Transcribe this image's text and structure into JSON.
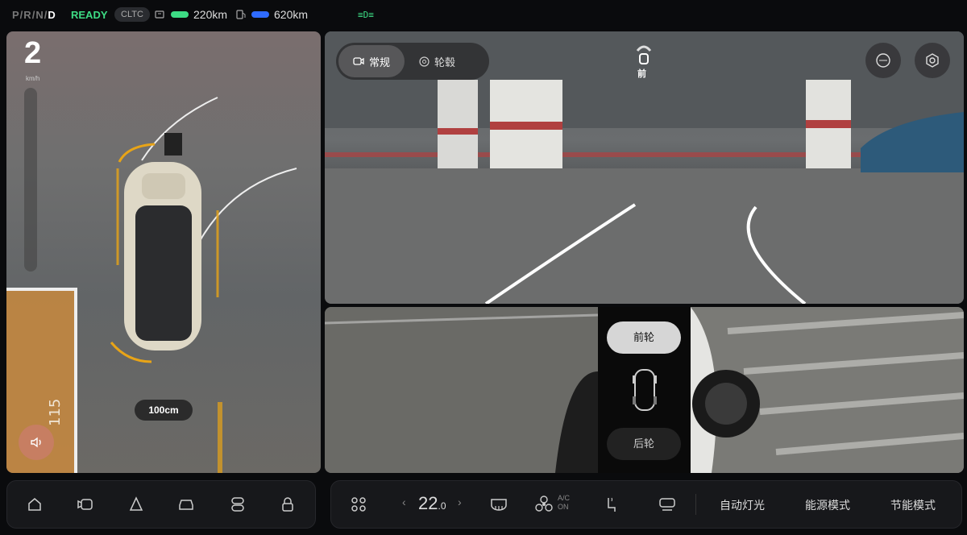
{
  "status": {
    "gears": [
      "P",
      "/",
      "R",
      "/",
      "N",
      "/",
      "D"
    ],
    "ready": "READY",
    "cltc": "CLTC",
    "range_total": "220km",
    "range_fuel": "620km",
    "light_indicator": "≡D≡",
    "battery_color": "#3ddc84",
    "fuel_color": "#2f6bff"
  },
  "left_view": {
    "speed": "2",
    "speed_unit": "km/h",
    "distance": "100cm"
  },
  "front_view": {
    "tabs": [
      {
        "label": "常规",
        "icon": "camera-icon"
      },
      {
        "label": "轮毂",
        "icon": "wheel-icon"
      }
    ],
    "camera_label": "前",
    "buttons": [
      "3d-view-icon",
      "settings-icon"
    ]
  },
  "wheel_view": {
    "front_wheel": "前轮",
    "rear_wheel": "后轮"
  },
  "dock": {
    "temperature": "22",
    "temperature_decimal": ".0",
    "ac_label": "A/C",
    "ac_state": "ON",
    "auto_light": "自动灯光",
    "energy_mode": "能源模式",
    "eco_mode": "节能模式"
  },
  "colors": {
    "accent_green": "#3ddc84",
    "radar_orange": "#e8a417"
  }
}
